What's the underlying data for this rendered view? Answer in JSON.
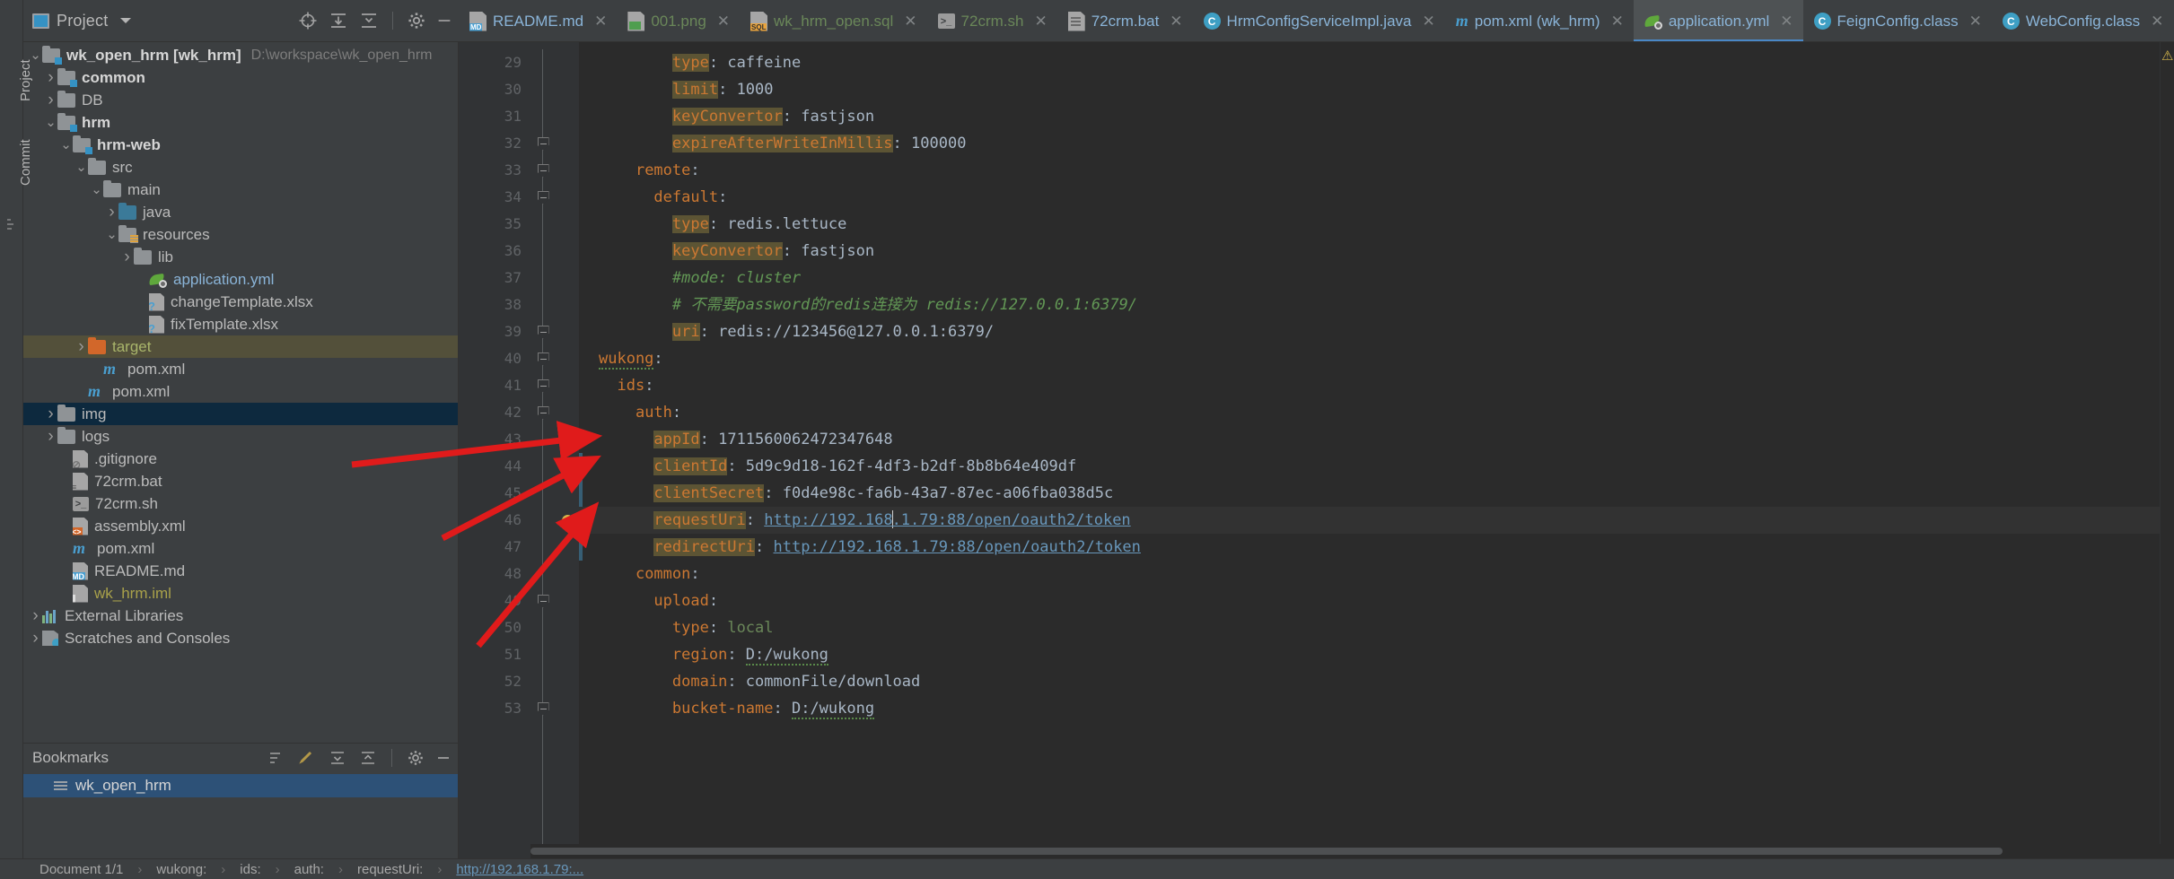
{
  "window": {
    "left_rail_labels": [
      "Project",
      "Commit"
    ]
  },
  "project_toolbar": {
    "title": "Project",
    "icons": [
      "locate-icon",
      "expand-all-icon",
      "collapse-all-icon",
      "gear-icon",
      "minimize-icon"
    ]
  },
  "tabs": [
    {
      "label": "README.md",
      "icon": "markdown-file-icon",
      "color": "blue",
      "active": false,
      "closable": true
    },
    {
      "label": "001.png",
      "icon": "image-file-icon",
      "color": "green",
      "active": false,
      "closable": true
    },
    {
      "label": "wk_hrm_open.sql",
      "icon": "sql-file-icon",
      "color": "green",
      "active": false,
      "closable": true
    },
    {
      "label": "72crm.sh",
      "icon": "shell-file-icon",
      "color": "green",
      "active": false,
      "closable": true
    },
    {
      "label": "72crm.bat",
      "icon": "bat-file-icon",
      "color": "blue",
      "active": false,
      "closable": true
    },
    {
      "label": "HrmConfigServiceImpl.java",
      "icon": "java-class-icon",
      "color": "blue",
      "active": false,
      "closable": true
    },
    {
      "label": "pom.xml (wk_hrm)",
      "icon": "maven-file-icon",
      "color": "blue",
      "active": false,
      "closable": true
    },
    {
      "label": "application.yml",
      "icon": "spring-yaml-icon",
      "color": "blue",
      "active": true,
      "closable": true
    },
    {
      "label": "FeignConfig.class",
      "icon": "java-class-icon",
      "color": "blue",
      "active": false,
      "closable": true
    },
    {
      "label": "WebConfig.class",
      "icon": "java-class-icon",
      "color": "blue",
      "active": false,
      "closable": true
    }
  ],
  "tree": [
    {
      "indent": 0,
      "arrow": "down",
      "icon": "module-folder-icon",
      "label": "wk_open_hrm [wk_hrm]",
      "bold": true,
      "path": "D:\\workspace\\wk_open_hrm",
      "state": "none"
    },
    {
      "indent": 1,
      "arrow": "right",
      "icon": "module-folder-icon",
      "label": "common",
      "bold": true,
      "path": "",
      "state": "none"
    },
    {
      "indent": 1,
      "arrow": "right",
      "icon": "folder-icon",
      "label": "DB",
      "bold": false,
      "path": "",
      "state": "none"
    },
    {
      "indent": 1,
      "arrow": "down",
      "icon": "module-folder-icon",
      "label": "hrm",
      "bold": true,
      "path": "",
      "state": "none"
    },
    {
      "indent": 2,
      "arrow": "down",
      "icon": "module-folder-icon",
      "label": "hrm-web",
      "bold": true,
      "path": "",
      "state": "none"
    },
    {
      "indent": 3,
      "arrow": "down",
      "icon": "folder-icon",
      "label": "src",
      "bold": false,
      "path": "",
      "state": "none"
    },
    {
      "indent": 4,
      "arrow": "down",
      "icon": "folder-icon",
      "label": "main",
      "bold": false,
      "path": "",
      "state": "none"
    },
    {
      "indent": 5,
      "arrow": "right",
      "icon": "source-folder-icon",
      "label": "java",
      "bold": false,
      "path": "",
      "state": "none"
    },
    {
      "indent": 5,
      "arrow": "down",
      "icon": "resource-folder-icon",
      "label": "resources",
      "bold": false,
      "path": "",
      "state": "none"
    },
    {
      "indent": 6,
      "arrow": "right",
      "icon": "folder-icon",
      "label": "lib",
      "bold": false,
      "path": "",
      "state": "none"
    },
    {
      "indent": 7,
      "arrow": "none",
      "icon": "spring-yaml-icon",
      "label": "application.yml",
      "bold": false,
      "path": "",
      "state": "none",
      "color": "blue"
    },
    {
      "indent": 7,
      "arrow": "none",
      "icon": "unknown-file-icon",
      "label": "changeTemplate.xlsx",
      "bold": false,
      "path": "",
      "state": "none"
    },
    {
      "indent": 7,
      "arrow": "none",
      "icon": "unknown-file-icon",
      "label": "fixTemplate.xlsx",
      "bold": false,
      "path": "",
      "state": "none"
    },
    {
      "indent": 3,
      "arrow": "right",
      "icon": "excluded-folder-icon",
      "label": "target",
      "bold": false,
      "path": "",
      "state": "olive",
      "color": "olive"
    },
    {
      "indent": 4,
      "arrow": "none",
      "icon": "maven-file-icon",
      "label": "pom.xml",
      "bold": false,
      "path": "",
      "state": "none"
    },
    {
      "indent": 3,
      "arrow": "none",
      "icon": "maven-file-icon",
      "label": "pom.xml",
      "bold": false,
      "path": "",
      "state": "none"
    },
    {
      "indent": 1,
      "arrow": "right",
      "icon": "folder-icon",
      "label": "img",
      "bold": false,
      "path": "",
      "state": "blue"
    },
    {
      "indent": 1,
      "arrow": "right",
      "icon": "folder-icon",
      "label": "logs",
      "bold": false,
      "path": "",
      "state": "none"
    },
    {
      "indent": 2,
      "arrow": "none",
      "icon": "gitignore-file-icon",
      "label": ".gitignore",
      "bold": false,
      "path": "",
      "state": "none"
    },
    {
      "indent": 2,
      "arrow": "none",
      "icon": "bat-file-icon",
      "label": "72crm.bat",
      "bold": false,
      "path": "",
      "state": "none"
    },
    {
      "indent": 2,
      "arrow": "none",
      "icon": "shell-file-icon",
      "label": "72crm.sh",
      "bold": false,
      "path": "",
      "state": "none"
    },
    {
      "indent": 2,
      "arrow": "none",
      "icon": "xml-file-icon",
      "label": "assembly.xml",
      "bold": false,
      "path": "",
      "state": "none"
    },
    {
      "indent": 2,
      "arrow": "none",
      "icon": "maven-file-icon",
      "label": "pom.xml",
      "bold": false,
      "path": "",
      "state": "none"
    },
    {
      "indent": 2,
      "arrow": "none",
      "icon": "markdown-file-icon",
      "label": "README.md",
      "bold": false,
      "path": "",
      "state": "none"
    },
    {
      "indent": 2,
      "arrow": "none",
      "icon": "iml-file-icon",
      "label": "wk_hrm.iml",
      "bold": false,
      "path": "",
      "state": "none",
      "color": "iml"
    },
    {
      "indent": 0,
      "arrow": "right",
      "icon": "external-libraries-icon",
      "label": "External Libraries",
      "bold": false,
      "path": "",
      "state": "none"
    },
    {
      "indent": 0,
      "arrow": "right",
      "icon": "scratches-icon",
      "label": "Scratches and Consoles",
      "bold": false,
      "path": "",
      "state": "none"
    }
  ],
  "bookmarks": {
    "title": "Bookmarks",
    "icons": [
      "sort-icon",
      "edit-icon",
      "expand-all-icon",
      "collapse-all-icon",
      "gear-icon",
      "minimize-icon"
    ],
    "items": [
      {
        "label": "wk_open_hrm",
        "icon": "bookmark-list-icon"
      }
    ]
  },
  "editor": {
    "first_line": 29,
    "lines": [
      {
        "n": 29,
        "indent": 4,
        "key": "type",
        "keyHl": true,
        "sep": ": ",
        "value": "caffeine",
        "vclass": "v"
      },
      {
        "n": 30,
        "indent": 4,
        "key": "limit",
        "keyHl": true,
        "sep": ": ",
        "value": "1000",
        "vclass": "num"
      },
      {
        "n": 31,
        "indent": 4,
        "key": "keyConvertor",
        "keyHl": true,
        "sep": ": ",
        "value": "fastjson",
        "vclass": "v"
      },
      {
        "n": 32,
        "indent": 4,
        "key": "expireAfterWriteInMillis",
        "keyHl": true,
        "sep": ": ",
        "value": "100000",
        "vclass": "num",
        "fold": true
      },
      {
        "n": 33,
        "indent": 2,
        "key": "remote",
        "keyHl": false,
        "sep": ":",
        "value": "",
        "vclass": "v",
        "fold": true
      },
      {
        "n": 34,
        "indent": 3,
        "key": "default",
        "keyHl": false,
        "sep": ":",
        "value": "",
        "vclass": "v",
        "fold": true
      },
      {
        "n": 35,
        "indent": 4,
        "key": "type",
        "keyHl": true,
        "sep": ": ",
        "value": "redis.lettuce",
        "vclass": "v"
      },
      {
        "n": 36,
        "indent": 4,
        "key": "keyConvertor",
        "keyHl": true,
        "sep": ": ",
        "value": "fastjson",
        "vclass": "v"
      },
      {
        "n": 37,
        "indent": 4,
        "comment": "#mode: cluster"
      },
      {
        "n": 38,
        "indent": 4,
        "comment": "# 不需要password的redis连接为 redis://127.0.0.1:6379/"
      },
      {
        "n": 39,
        "indent": 4,
        "key": "uri",
        "keyHl": true,
        "sep": ": ",
        "value": "redis://123456@127.0.0.1:6379/",
        "vclass": "v",
        "fold": true
      },
      {
        "n": 40,
        "indent": 0,
        "key": "wukong",
        "keyHl": false,
        "sep": ":",
        "value": "",
        "vclass": "v",
        "fold": true,
        "wavy": true
      },
      {
        "n": 41,
        "indent": 1,
        "key": "ids",
        "keyHl": false,
        "sep": ":",
        "value": "",
        "vclass": "v",
        "fold": true
      },
      {
        "n": 42,
        "indent": 2,
        "key": "auth",
        "keyHl": false,
        "sep": ":",
        "value": "",
        "vclass": "v",
        "fold": true
      },
      {
        "n": 43,
        "indent": 3,
        "key": "appId",
        "keyHl": true,
        "sep": ": ",
        "value": "1711560062472347648",
        "vclass": "num"
      },
      {
        "n": 44,
        "indent": 3,
        "key": "clientId",
        "keyHl": true,
        "sep": ": ",
        "value": "5d9c9d18-162f-4df3-b2df-8b8b64e409df",
        "vclass": "v",
        "changed": true
      },
      {
        "n": 45,
        "indent": 3,
        "key": "clientSecret",
        "keyHl": true,
        "sep": ": ",
        "value": "f0d4e98c-fa6b-43a7-87ec-a06fba038d5c",
        "vclass": "v",
        "changed": true
      },
      {
        "n": 46,
        "indent": 3,
        "key": "requestUri",
        "keyHl": true,
        "sep": ": ",
        "value": "http://192.168.1.79:88/open/oauth2/token",
        "vclass": "link",
        "bulb": true,
        "current": true,
        "caretAfter": 14
      },
      {
        "n": 47,
        "indent": 3,
        "key": "redirectUri",
        "keyHl": true,
        "sep": ": ",
        "value": "http://192.168.1.79:88/open/oauth2/token",
        "vclass": "link",
        "changed": true
      },
      {
        "n": 48,
        "indent": 2,
        "key": "common",
        "keyHl": false,
        "sep": ":",
        "value": "",
        "vclass": "v"
      },
      {
        "n": 49,
        "indent": 3,
        "key": "upload",
        "keyHl": false,
        "sep": ":",
        "value": "",
        "vclass": "v",
        "fold": true
      },
      {
        "n": 50,
        "indent": 4,
        "key": "type",
        "keyHl": false,
        "sep": ": ",
        "value": "local",
        "vclass": "str"
      },
      {
        "n": 51,
        "indent": 4,
        "key": "region",
        "keyHl": false,
        "sep": ": ",
        "value": "D:/wukong",
        "vclass": "v",
        "wavyValue": true
      },
      {
        "n": 52,
        "indent": 4,
        "key": "domain",
        "keyHl": false,
        "sep": ": ",
        "value": "commonFile/download",
        "vclass": "v"
      },
      {
        "n": 53,
        "indent": 4,
        "key": "bucket-name",
        "keyHl": false,
        "sep": ": ",
        "value": "D:/wukong",
        "vclass": "v",
        "wavyValue": true,
        "fold": true
      }
    ]
  },
  "statusbar": {
    "document": "Document 1/1",
    "crumbs": [
      "wukong:",
      "ids:",
      "auth:",
      "requestUri:",
      "http://192.168.1.79:..."
    ]
  },
  "colors": {
    "accent_blue": "#4a88c7",
    "key_orange": "#cc7832",
    "key_highlight": "#5c5434",
    "comment_green": "#629755",
    "link_blue": "#6897bb",
    "selection_blue": "#0d293e",
    "selection_olive": "#53503a",
    "annotation_red": "#e01b1b"
  }
}
